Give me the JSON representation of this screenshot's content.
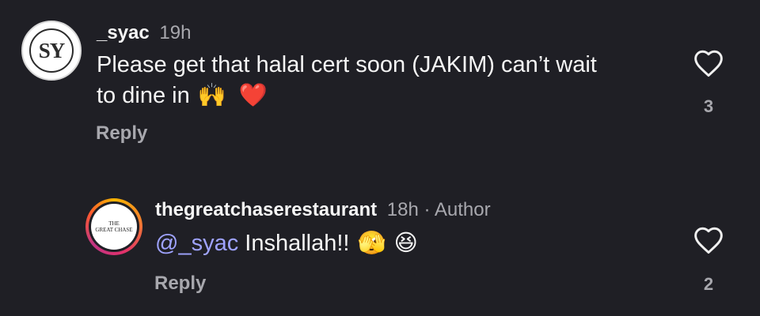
{
  "comments": [
    {
      "username": "_syac",
      "time": "19h",
      "avatar_initials": "SY",
      "text_line1": "Please get that halal cert soon (JAKIM) can’t wait",
      "text_line2": "to dine in",
      "emojis": [
        "🙌",
        "❤️"
      ],
      "reply_label": "Reply",
      "like_count": "3",
      "heart_icon": "heart-outline-icon"
    },
    {
      "username": "thegreatchaserestaurant",
      "time": "18h",
      "separator": " · ",
      "author_label": "Author",
      "avatar_logo_line1": "THE",
      "avatar_logo_line2": "GREAT CHASE",
      "mention": "@_syac",
      "text": "Inshallah!!",
      "emojis": [
        "🫣",
        "😆"
      ],
      "reply_label": "Reply",
      "like_count": "2",
      "heart_icon": "heart-outline-icon"
    }
  ],
  "colors": {
    "background": "#1f1f25",
    "primary_text": "#f5f5f5",
    "secondary_text": "#a8a8ae",
    "mention": "#9fa3ff"
  }
}
